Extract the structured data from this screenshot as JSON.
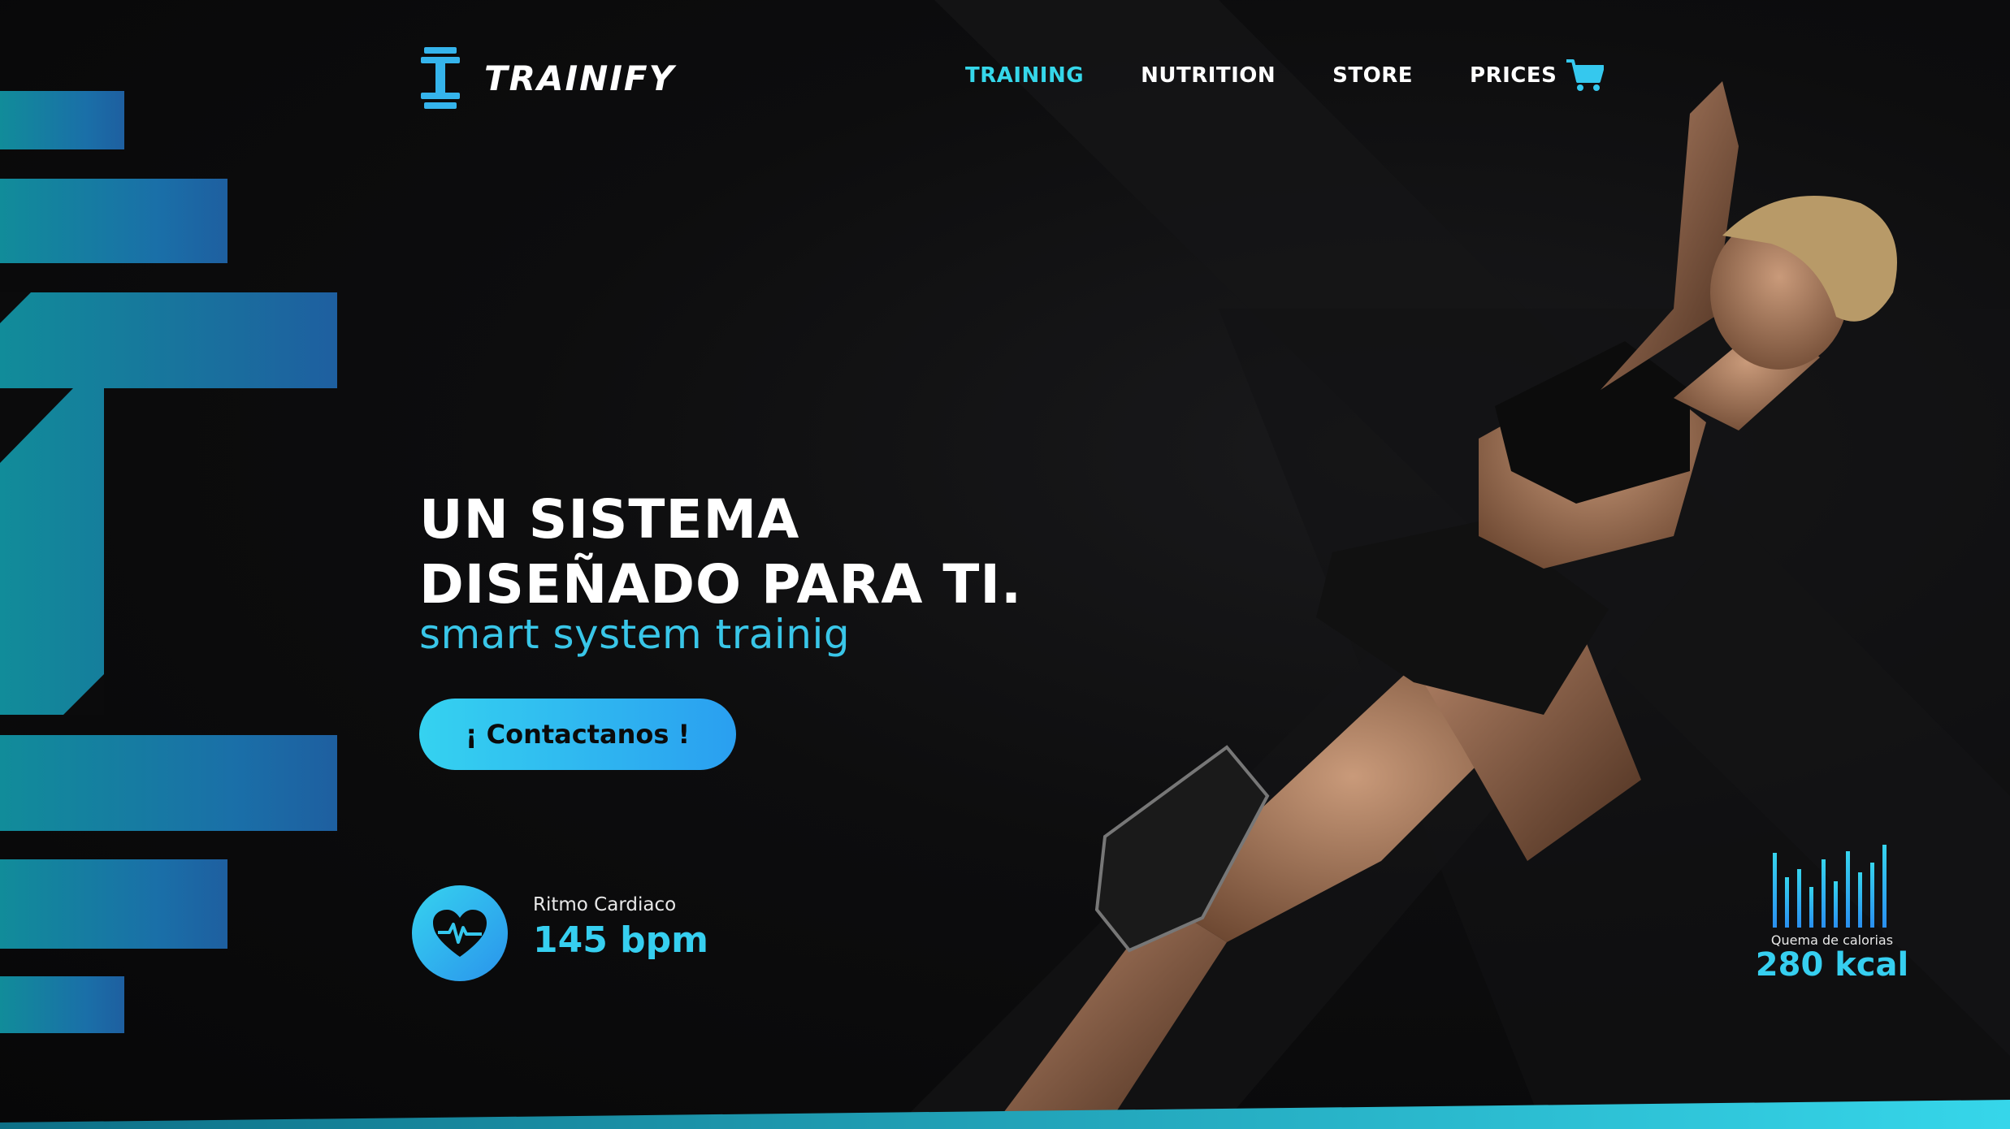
{
  "brand": {
    "name": "TRAINIFY",
    "accent": "#35d7ea",
    "accent_blue": "#2a9ff0"
  },
  "nav": {
    "items": [
      {
        "label": "TRAINING",
        "active": true
      },
      {
        "label": "NUTRITION",
        "active": false
      },
      {
        "label": "STORE",
        "active": false
      },
      {
        "label": "PRICES",
        "active": false
      }
    ],
    "cart_icon": "shopping-cart-icon"
  },
  "hero": {
    "headline_line1": "UN SISTEMA",
    "headline_line2": "DISEÑADO PARA TI.",
    "subline": "smart system trainig",
    "cta_label": "¡ Contactanos !"
  },
  "heart_rate": {
    "icon": "heart-pulse-icon",
    "label": "Ritmo Cardiaco",
    "value": "145 bpm"
  },
  "calories": {
    "icon": "equalizer-bars-icon",
    "label": "Quema de calorias",
    "value": "280 kcal"
  }
}
